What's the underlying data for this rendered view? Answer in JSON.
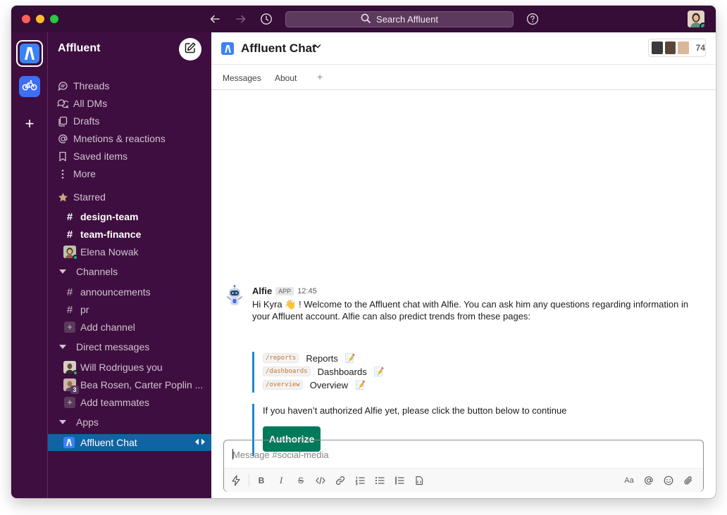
{
  "titlebar": {
    "search_label": "Search Affluent"
  },
  "sidebar": {
    "workspace_name": "Affluent",
    "nav": [
      "Threads",
      "All DMs",
      "Drafts",
      "Mnetions & reactions",
      "Saved items",
      "More"
    ],
    "starred_label": "Starred",
    "starred": [
      "design-team",
      "team-finance"
    ],
    "starred_dm": "Elena Nowak",
    "channels_label": "Channels",
    "channels": [
      "announcements",
      "pr"
    ],
    "add_channel": "Add channel",
    "dms_label": "Direct messages",
    "dms": [
      "Will Rodrigues you",
      "Bea Rosen, Carter Poplin ..."
    ],
    "dm_group_count": "3",
    "add_teammates": "Add teammates",
    "apps_label": "Apps",
    "active_app": "Affluent Chat"
  },
  "channel": {
    "title": "Affluent Chat",
    "member_count": "74",
    "tabs": [
      "Messages",
      "About",
      "+"
    ]
  },
  "message": {
    "sender": "Alfie",
    "badge": "APP",
    "time": "12:45",
    "text": "Hi Kyra 👋 ! Welcome to the Affluent chat with Alfie. You can ask him any questions regarding information in your Affluent account. Alfie can also predict trends from these pages:",
    "pages": [
      {
        "path": "/reports",
        "name": "Reports"
      },
      {
        "path": "/dashboards",
        "name": "Dashboards"
      },
      {
        "path": "/overview",
        "name": "Overview"
      }
    ],
    "auth_note": "If you haven’t authorized Alfie yet, please click the button below to continue",
    "auth_button": "Authorize"
  },
  "composer": {
    "placeholder": "Message #social-media"
  },
  "colors": {
    "aubergine": "#3f0e40",
    "titlebar": "#350d36",
    "active_item": "#1164a3",
    "authorize": "#007a5a",
    "presence": "#2bac76",
    "quote_bar": "#1e88c7"
  }
}
